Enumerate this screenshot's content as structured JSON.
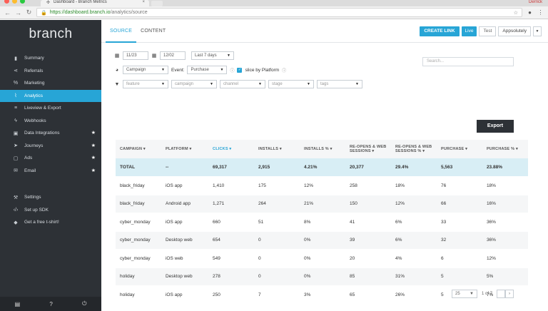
{
  "browser": {
    "tab_title": "Dashboard - Branch Metrics",
    "profile": "Derrick",
    "url_secure": "https://dashboard.branch.io",
    "url_path": "/analytics/source"
  },
  "brand": "branch",
  "sidebar": {
    "items": [
      {
        "label": "Summary",
        "icon": "bar-chart-icon"
      },
      {
        "label": "Referrals",
        "icon": "share-icon"
      },
      {
        "label": "Marketing",
        "icon": "link-icon"
      },
      {
        "label": "Analytics",
        "icon": "line-chart-icon",
        "active": true
      },
      {
        "label": "Liveview & Export",
        "icon": "database-icon"
      },
      {
        "label": "Webhooks",
        "icon": "bolt-icon"
      },
      {
        "label": "Data Integrations",
        "icon": "integrations-icon",
        "star": true
      },
      {
        "label": "Journeys",
        "icon": "paper-plane-icon",
        "star": true
      },
      {
        "label": "Ads",
        "icon": "ads-icon",
        "star": true
      },
      {
        "label": "Email",
        "icon": "email-icon",
        "star": true
      }
    ],
    "secondary": [
      {
        "label": "Settings",
        "icon": "wrench-icon"
      },
      {
        "label": "Set up SDK",
        "icon": "code-icon"
      },
      {
        "label": "Get a free t-shirt!",
        "icon": "shirt-icon"
      }
    ]
  },
  "topnav": {
    "tabs": [
      "SOURCE",
      "CONTENT"
    ],
    "create_link": "CREATE LINK",
    "live": "Live",
    "test": "Test",
    "org": "Appsolutely"
  },
  "filters": {
    "start_date": "11/23",
    "end_date": "12/02",
    "range": "Last 7 days",
    "group_by": "Campaign",
    "event_label": "Event:",
    "event": "Purchase",
    "slice_label": "slice by Platform",
    "feature": "feature",
    "campaign": "campaign",
    "channel": "channel",
    "stage": "stage",
    "tags": "tags",
    "search_placeholder": "Search..."
  },
  "export_label": "Export",
  "table": {
    "headers": [
      "CAMPAIGN ▾",
      "PLATFORM ▾",
      "CLICKS ▾",
      "INSTALLS ▾",
      "INSTALLS % ▾",
      "RE-OPENS & WEB SESSIONS ▾",
      "RE-OPENS & WEB SESSIONS % ▾",
      "PURCHASE ▾",
      "PURCHASE % ▾"
    ],
    "total": [
      "TOTAL",
      "--",
      "69,317",
      "2,915",
      "4.21%",
      "20,377",
      "29.4%",
      "5,563",
      "23.88%"
    ],
    "rows": [
      [
        "black_friday",
        "iOS app",
        "1,410",
        "175",
        "12%",
        "258",
        "18%",
        "76",
        "18%"
      ],
      [
        "black_friday",
        "Android app",
        "1,271",
        "264",
        "21%",
        "150",
        "12%",
        "66",
        "16%"
      ],
      [
        "cyber_monday",
        "iOS app",
        "660",
        "51",
        "8%",
        "41",
        "6%",
        "33",
        "36%"
      ],
      [
        "cyber_monday",
        "Desktop web",
        "654",
        "0",
        "0%",
        "39",
        "6%",
        "32",
        "36%"
      ],
      [
        "cyber_monday",
        "iOS web",
        "549",
        "0",
        "0%",
        "20",
        "4%",
        "6",
        "12%"
      ],
      [
        "holiday",
        "Desktop web",
        "278",
        "0",
        "0%",
        "85",
        "31%",
        "5",
        "5%"
      ],
      [
        "holiday",
        "iOS app",
        "250",
        "7",
        "3%",
        "65",
        "26%",
        "5",
        "7%"
      ]
    ]
  },
  "pager": {
    "page_size": "25",
    "page_info": "1 of 7"
  },
  "colors": {
    "accent": "#27a5d6",
    "sidebar_bg": "#2d3136",
    "total_row": "#d8eef5"
  }
}
